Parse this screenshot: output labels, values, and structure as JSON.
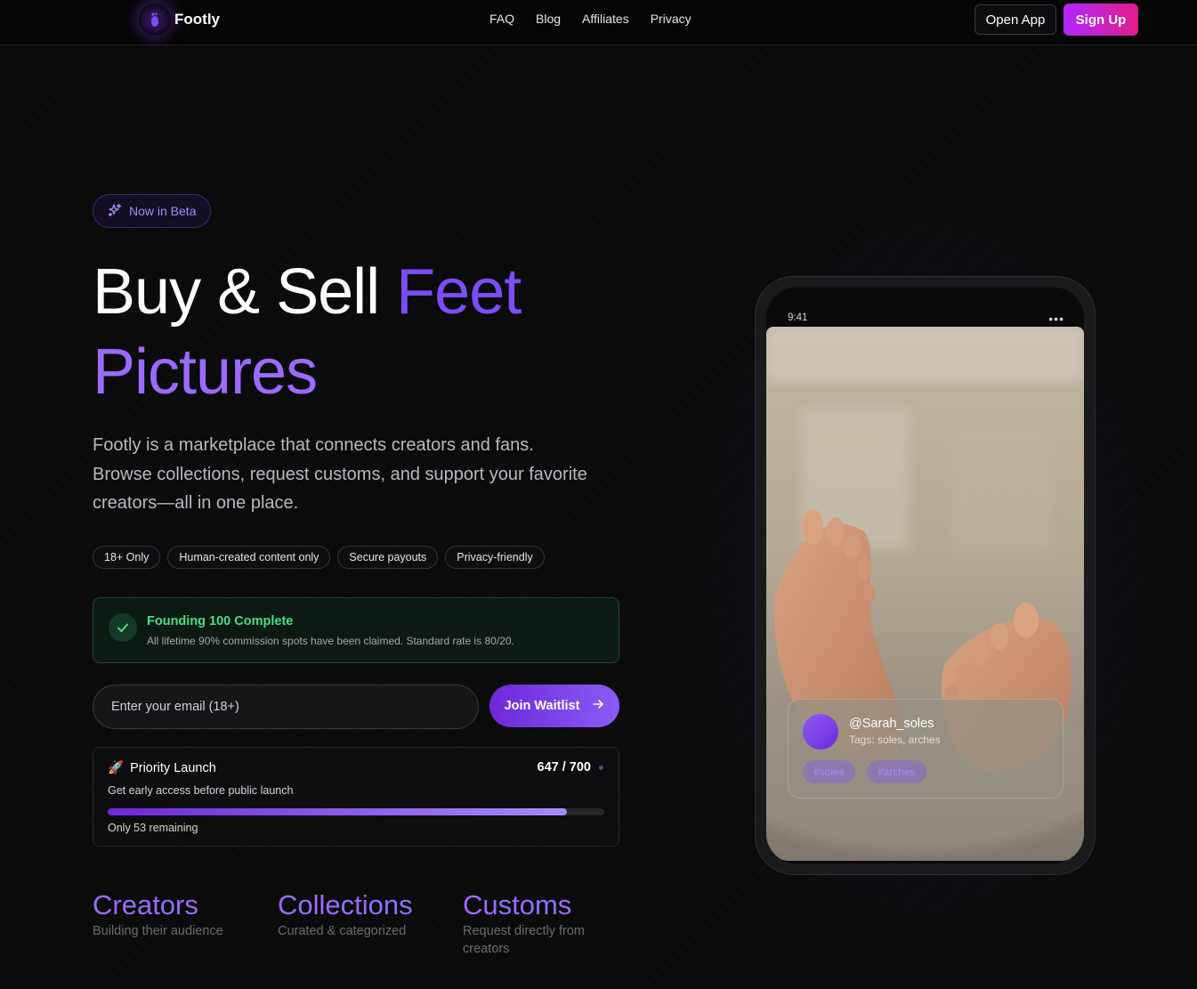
{
  "nav": {
    "brand": "Footly",
    "links": [
      "FAQ",
      "Blog",
      "Affiliates",
      "Privacy"
    ],
    "open_app": "Open App",
    "sign_up": "Sign Up"
  },
  "hero": {
    "badge": "Now in Beta",
    "title_part1": "Buy & Sell ",
    "title_part2": "Feet",
    "title_part3": "Pictures",
    "lede": "Footly is a marketplace that connects creators and fans. Browse collections, request customs, and support your favorite creators—all in one place.",
    "pills": [
      "18+ Only",
      "Human-created content only",
      "Secure payouts",
      "Privacy-friendly"
    ]
  },
  "founding": {
    "title": "Founding 100 Complete",
    "subtitle": "All lifetime 90% commission spots have been claimed. Standard rate is 80/20."
  },
  "waitlist": {
    "email_placeholder": "Enter your email (18+)",
    "join_label": "Join Waitlist"
  },
  "priority": {
    "title": "Priority Launch",
    "count": "647 / 700",
    "subtitle": "Get early access before public launch",
    "progress_fraction": 0.924,
    "remaining": "Only 53 remaining"
  },
  "stats": [
    {
      "heading": "Creators",
      "sub": "Building their audience"
    },
    {
      "heading": "Collections",
      "sub": "Curated & categorized"
    },
    {
      "heading": "Customs",
      "sub": "Request directly from creators"
    }
  ],
  "phone": {
    "time": "9:41",
    "menu": "•••",
    "handle": "@Sarah_soles",
    "tags_line": "Tags: soles, arches",
    "hashtags": [
      "#soles",
      "#arches"
    ]
  },
  "colors": {
    "accent": "#7c4dff",
    "brand_gradient_start": "#b026ff",
    "brand_gradient_end": "#e11d8a",
    "success": "#4ade80",
    "background": "#0b0b0c"
  }
}
